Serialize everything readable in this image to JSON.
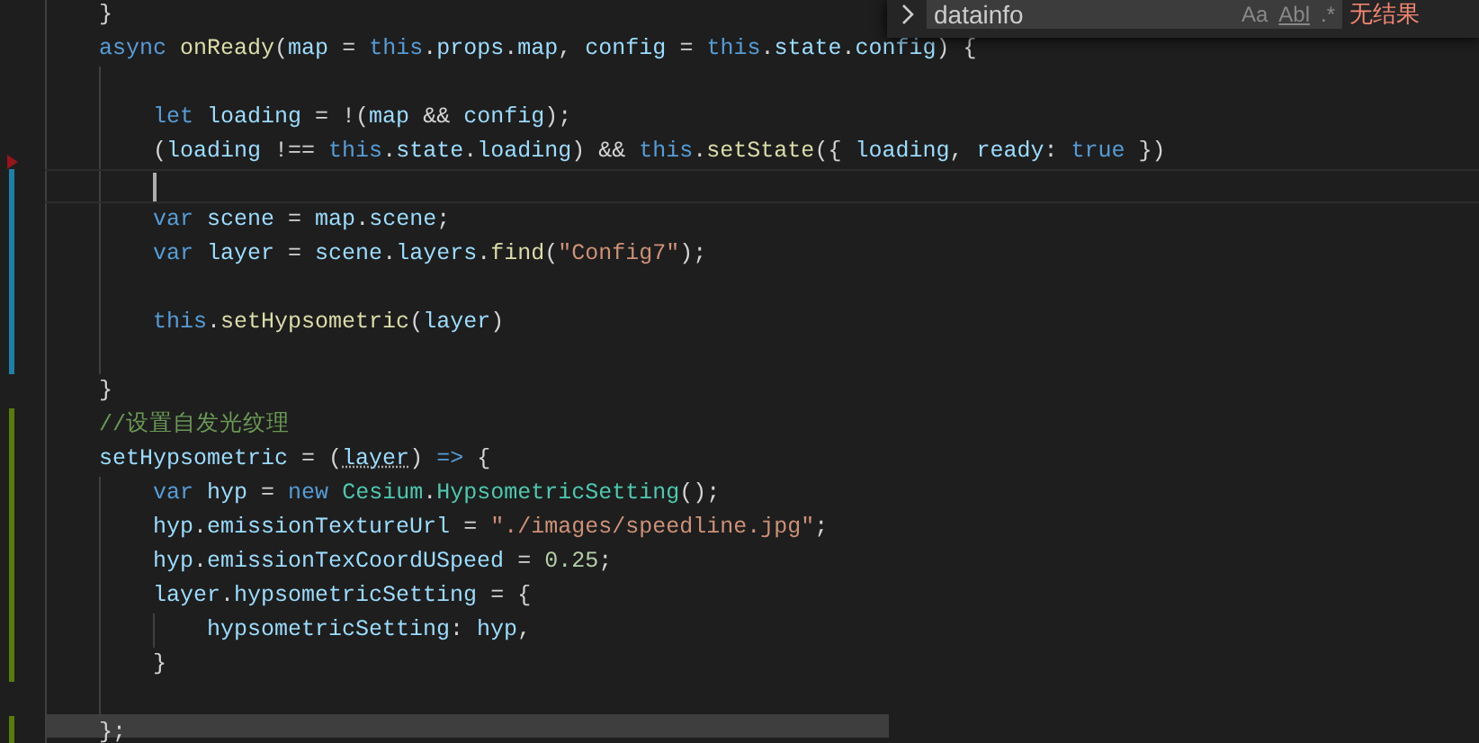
{
  "editor": {
    "lines": [
      {
        "kind": "plain",
        "current": false,
        "tokens": [
          {
            "text": "}",
            "kind": "punc"
          }
        ]
      },
      {
        "kind": "plain",
        "current": false,
        "tokens": [
          {
            "text": "async",
            "kind": "keyword"
          },
          {
            "text": " onReady",
            "kind": "function"
          },
          {
            "text": "(",
            "kind": "punc"
          },
          {
            "text": "map",
            "kind": "variable"
          },
          {
            "text": " = ",
            "kind": "punc"
          },
          {
            "text": "this",
            "kind": "keyword"
          },
          {
            "text": ".",
            "kind": "punc"
          },
          {
            "text": "props",
            "kind": "variable"
          },
          {
            "text": ".",
            "kind": "punc"
          },
          {
            "text": "map",
            "kind": "variable"
          },
          {
            "text": ", ",
            "kind": "punc"
          },
          {
            "text": "config",
            "kind": "variable"
          },
          {
            "text": " = ",
            "kind": "punc"
          },
          {
            "text": "this",
            "kind": "keyword"
          },
          {
            "text": ".",
            "kind": "punc"
          },
          {
            "text": "state",
            "kind": "variable"
          },
          {
            "text": ".",
            "kind": "punc"
          },
          {
            "text": "config",
            "kind": "variable"
          },
          {
            "text": ") {",
            "kind": "punc"
          }
        ],
        "children": [
          {
            "kind": "plain",
            "current": false
          },
          {
            "kind": "plain",
            "current": false,
            "tokens": [
              {
                "text": "let",
                "kind": "keyword"
              },
              {
                "text": " loading",
                "kind": "variable"
              },
              {
                "text": " = !(",
                "kind": "punc"
              },
              {
                "text": "map",
                "kind": "variable"
              },
              {
                "text": " && ",
                "kind": "punc"
              },
              {
                "text": "config",
                "kind": "variable"
              },
              {
                "text": ");",
                "kind": "punc"
              }
            ]
          },
          {
            "kind": "deleted",
            "current": false,
            "tokens": [
              {
                "text": "(",
                "kind": "punc"
              },
              {
                "text": "loading",
                "kind": "variable"
              },
              {
                "text": " !== ",
                "kind": "punc"
              },
              {
                "text": "this",
                "kind": "keyword"
              },
              {
                "text": ".",
                "kind": "punc"
              },
              {
                "text": "state",
                "kind": "variable"
              },
              {
                "text": ".",
                "kind": "punc"
              },
              {
                "text": "loading",
                "kind": "variable"
              },
              {
                "text": ") && ",
                "kind": "punc"
              },
              {
                "text": "this",
                "kind": "keyword"
              },
              {
                "text": ".",
                "kind": "punc"
              },
              {
                "text": "setState",
                "kind": "function"
              },
              {
                "text": "({ ",
                "kind": "punc"
              },
              {
                "text": "loading",
                "kind": "variable"
              },
              {
                "text": ", ",
                "kind": "punc"
              },
              {
                "text": "ready",
                "kind": "variable"
              },
              {
                "text": ": ",
                "kind": "punc"
              },
              {
                "text": "true",
                "kind": "keyword"
              },
              {
                "text": " })",
                "kind": "punc"
              }
            ]
          },
          {
            "kind": "modified",
            "current": true
          },
          {
            "kind": "modified",
            "current": false,
            "tokens": [
              {
                "text": "var",
                "kind": "keyword"
              },
              {
                "text": " scene",
                "kind": "variable"
              },
              {
                "text": " = ",
                "kind": "punc"
              },
              {
                "text": "map",
                "kind": "variable"
              },
              {
                "text": ".",
                "kind": "punc"
              },
              {
                "text": "scene",
                "kind": "variable"
              },
              {
                "text": ";",
                "kind": "punc"
              }
            ]
          },
          {
            "kind": "modified",
            "current": false,
            "tokens": [
              {
                "text": "var",
                "kind": "keyword"
              },
              {
                "text": " layer",
                "kind": "variable"
              },
              {
                "text": " = ",
                "kind": "punc"
              },
              {
                "text": "scene",
                "kind": "variable"
              },
              {
                "text": ".",
                "kind": "punc"
              },
              {
                "text": "layers",
                "kind": "variable"
              },
              {
                "text": ".",
                "kind": "punc"
              },
              {
                "text": "find",
                "kind": "function"
              },
              {
                "text": "(",
                "kind": "punc"
              },
              {
                "text": "\"Config7\"",
                "kind": "string"
              },
              {
                "text": ");",
                "kind": "punc"
              }
            ]
          },
          {
            "kind": "modified",
            "current": false
          },
          {
            "kind": "modified",
            "current": false,
            "tokens": [
              {
                "text": "this",
                "kind": "keyword"
              },
              {
                "text": ".",
                "kind": "punc"
              },
              {
                "text": "setHypsometric",
                "kind": "function"
              },
              {
                "text": "(",
                "kind": "punc"
              },
              {
                "text": "layer",
                "kind": "variable"
              },
              {
                "text": ")",
                "kind": "punc"
              }
            ]
          },
          {
            "kind": "modified",
            "current": false
          }
        ]
      },
      {
        "kind": "plain",
        "current": false,
        "tokens": [
          {
            "text": "}",
            "kind": "punc"
          }
        ]
      },
      {
        "kind": "added",
        "current": false,
        "tokens": [
          {
            "text": "//设置自发光纹理",
            "kind": "comment"
          }
        ]
      },
      {
        "kind": "added",
        "current": false,
        "tokens": [
          {
            "text": "setHypsometric",
            "kind": "variable"
          },
          {
            "text": " = (",
            "kind": "punc"
          },
          {
            "text": "layer",
            "kind": "variable",
            "hint": true
          },
          {
            "text": ") ",
            "kind": "punc"
          },
          {
            "text": "=>",
            "kind": "keyword"
          },
          {
            "text": " {",
            "kind": "punc"
          }
        ],
        "children": [
          {
            "kind": "added",
            "current": false,
            "tokens": [
              {
                "text": "var",
                "kind": "keyword"
              },
              {
                "text": " hyp",
                "kind": "variable"
              },
              {
                "text": " = ",
                "kind": "punc"
              },
              {
                "text": "new",
                "kind": "keyword"
              },
              {
                "text": " Cesium",
                "kind": "class"
              },
              {
                "text": ".",
                "kind": "punc"
              },
              {
                "text": "HypsometricSetting",
                "kind": "class"
              },
              {
                "text": "();",
                "kind": "punc"
              }
            ]
          },
          {
            "kind": "added",
            "current": false,
            "tokens": [
              {
                "text": "hyp",
                "kind": "variable"
              },
              {
                "text": ".",
                "kind": "punc"
              },
              {
                "text": "emissionTextureUrl",
                "kind": "variable"
              },
              {
                "text": " = ",
                "kind": "punc"
              },
              {
                "text": "\"./images/speedline.jpg\"",
                "kind": "string"
              },
              {
                "text": ";",
                "kind": "punc"
              }
            ]
          },
          {
            "kind": "added",
            "current": false,
            "tokens": [
              {
                "text": "hyp",
                "kind": "variable"
              },
              {
                "text": ".",
                "kind": "punc"
              },
              {
                "text": "emissionTexCoordUSpeed",
                "kind": "variable"
              },
              {
                "text": " = ",
                "kind": "punc"
              },
              {
                "text": "0.25",
                "kind": "number"
              },
              {
                "text": ";",
                "kind": "punc"
              }
            ]
          },
          {
            "kind": "added",
            "current": false,
            "tokens": [
              {
                "text": "layer",
                "kind": "variable"
              },
              {
                "text": ".",
                "kind": "punc"
              },
              {
                "text": "hypsometricSetting",
                "kind": "variable"
              },
              {
                "text": " = {",
                "kind": "punc"
              }
            ],
            "children": [
              {
                "kind": "added",
                "current": false,
                "tokens": [
                  {
                    "text": "hypsometricSetting",
                    "kind": "variable"
                  },
                  {
                    "text": ": ",
                    "kind": "punc"
                  },
                  {
                    "text": "hyp",
                    "kind": "variable"
                  },
                  {
                    "text": ",",
                    "kind": "punc"
                  }
                ]
              }
            ]
          },
          {
            "kind": "added",
            "current": false,
            "tokens": [
              {
                "text": "}",
                "kind": "punc"
              }
            ]
          },
          {
            "kind": "plain",
            "current": false
          }
        ]
      },
      {
        "kind": "added",
        "current": false,
        "tokens": [
          {
            "text": "};",
            "kind": "punc"
          }
        ]
      }
    ]
  },
  "find_widget": {
    "value": "datainfo",
    "options": [
      "Aa",
      "Abl",
      ".*"
    ],
    "result": "无结果"
  }
}
